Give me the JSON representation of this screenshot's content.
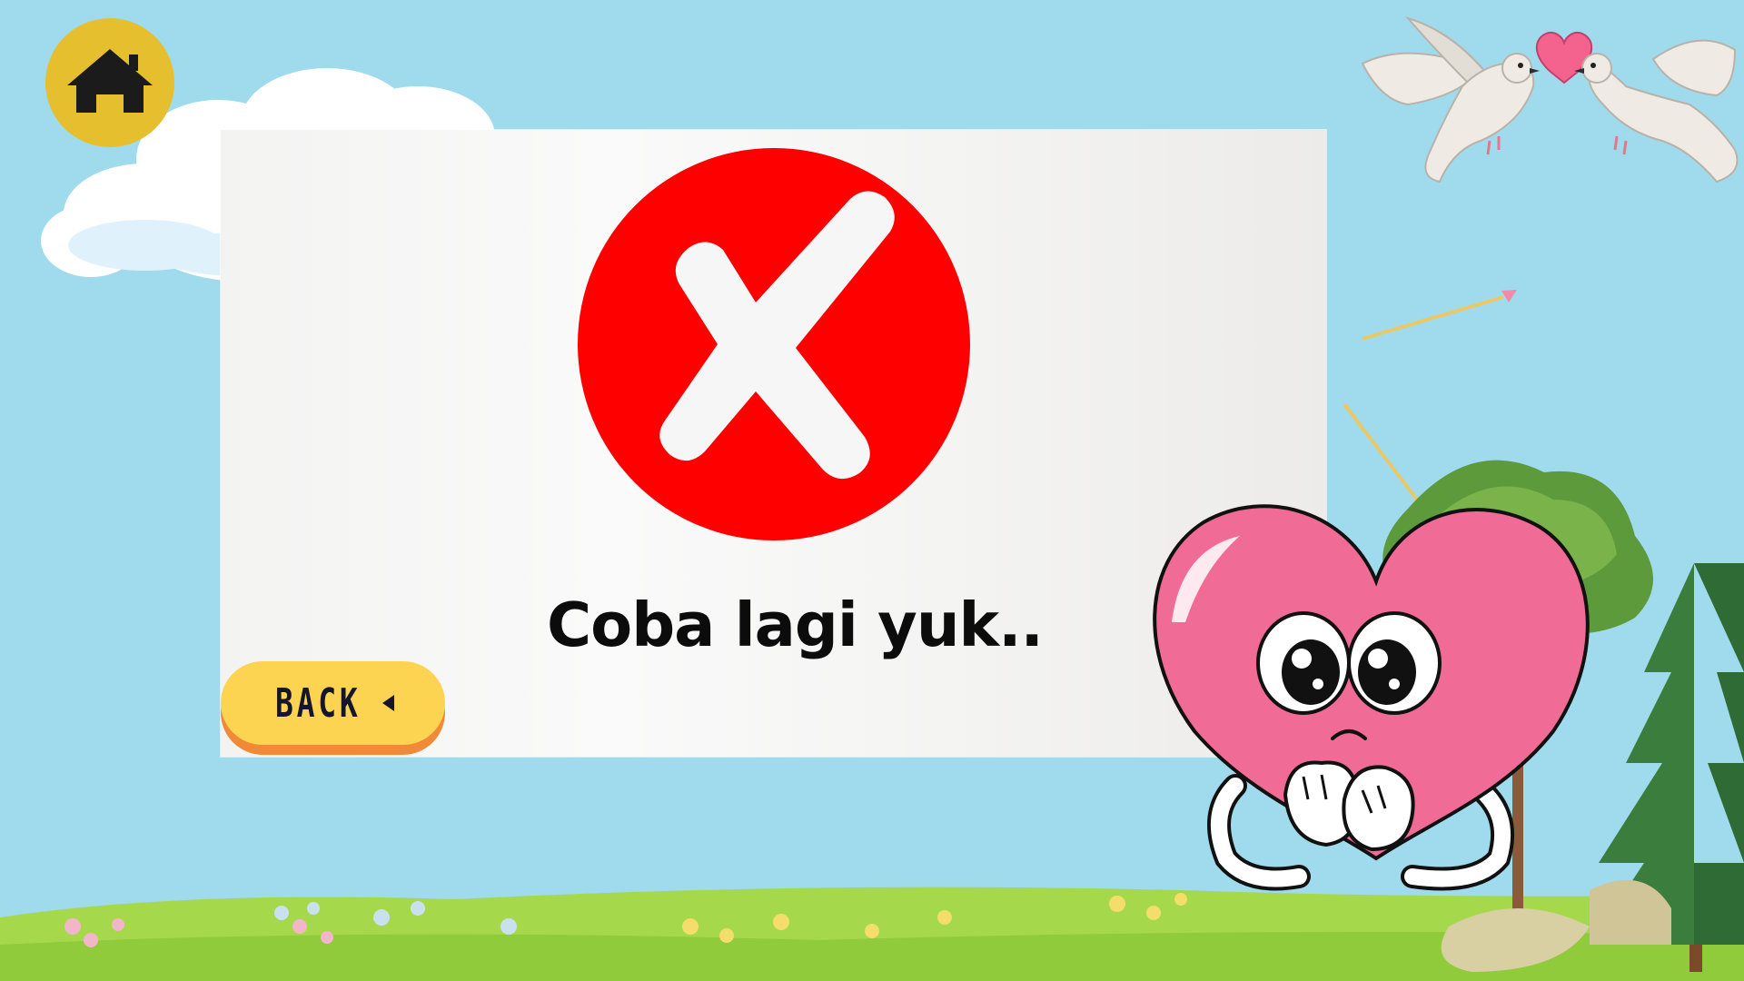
{
  "screen": {
    "message": "Coba lagi yuk..",
    "back_label": "BACK"
  },
  "icons": {
    "home": "home-icon",
    "result": "wrong-x-icon",
    "back_arrow": "caret-left-icon"
  },
  "colors": {
    "sky": "#9fdbec",
    "home_button": "#e5bf2e",
    "wrong_circle": "#fe0000",
    "back_button": "#fcd452",
    "back_button_edge": "#f08a38",
    "heart": "#f06b96",
    "grass": "#a5d94b"
  }
}
